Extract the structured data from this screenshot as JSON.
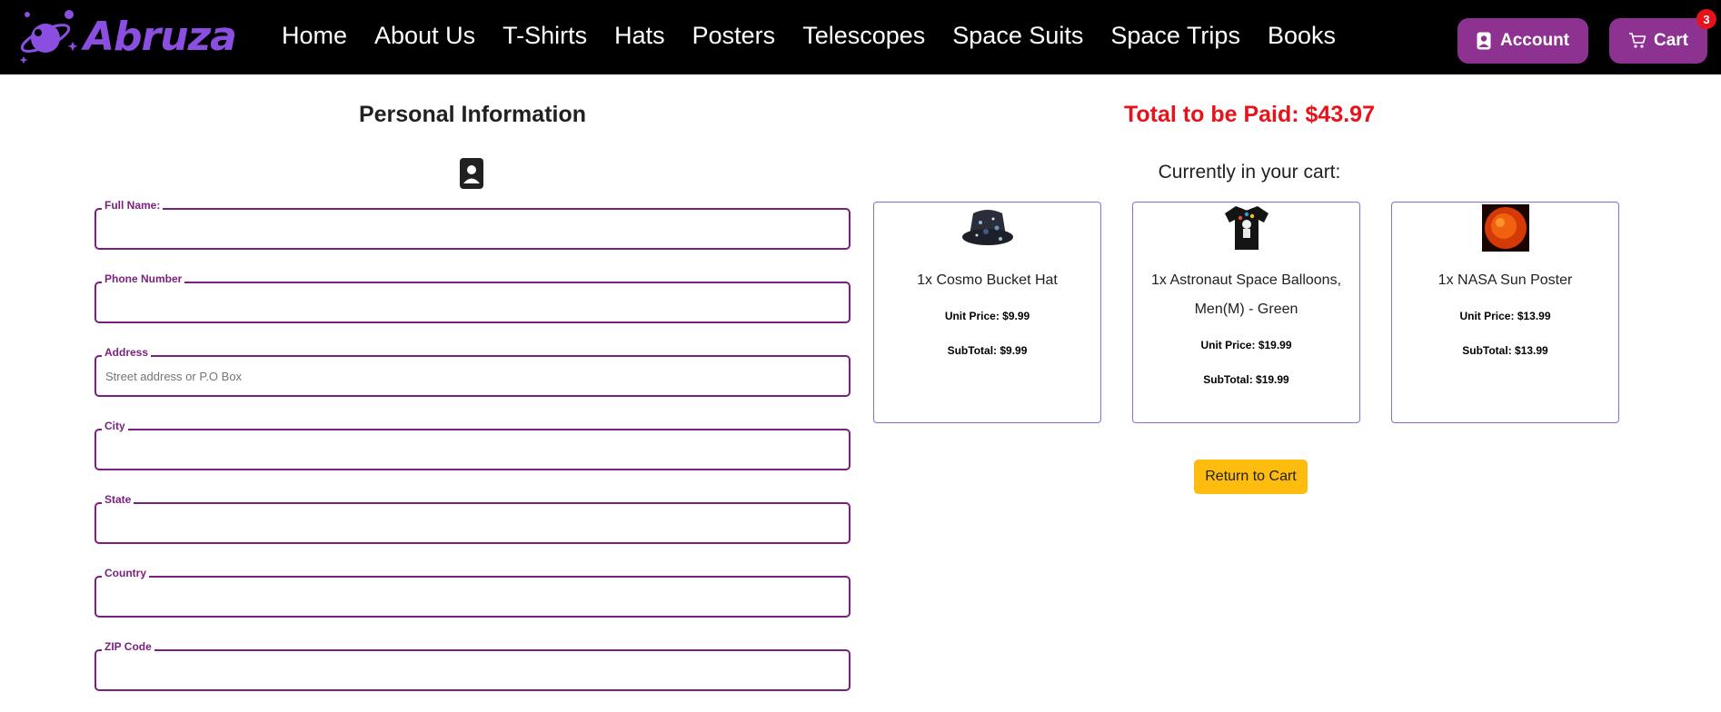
{
  "brand": {
    "name": "Abruza",
    "accent": "#8a4fe0"
  },
  "nav": {
    "links": [
      {
        "label": "Home"
      },
      {
        "label": "About Us"
      },
      {
        "label": "T-Shirts"
      },
      {
        "label": "Hats"
      },
      {
        "label": "Posters"
      },
      {
        "label": "Telescopes"
      },
      {
        "label": "Space Suits"
      },
      {
        "label": "Space Trips"
      },
      {
        "label": "Books"
      }
    ],
    "account_label": "Account",
    "cart_label": "Cart",
    "cart_count": "3"
  },
  "form": {
    "title": "Personal Information",
    "fields": [
      {
        "label": "Full Name:",
        "value": "",
        "placeholder": ""
      },
      {
        "label": "Phone Number",
        "value": "",
        "placeholder": ""
      },
      {
        "label": "Address",
        "value": "",
        "placeholder": "Street address or P.O Box"
      },
      {
        "label": "City",
        "value": "",
        "placeholder": ""
      },
      {
        "label": "State",
        "value": "",
        "placeholder": ""
      },
      {
        "label": "Country",
        "value": "",
        "placeholder": ""
      },
      {
        "label": "ZIP Code",
        "value": "",
        "placeholder": ""
      }
    ]
  },
  "summary": {
    "total_text": "Total to be Paid: $43.97",
    "cart_heading": "Currently in your cart:",
    "items": [
      {
        "name": "1x Cosmo Bucket Hat",
        "unit_price": "Unit Price: $9.99",
        "subtotal": "SubTotal: $9.99",
        "image": "bucket-hat"
      },
      {
        "name": "1x Astronaut Space Balloons, Men(M) - Green",
        "unit_price": "Unit Price: $19.99",
        "subtotal": "SubTotal: $19.99",
        "image": "astronaut-tshirt"
      },
      {
        "name": "1x NASA Sun Poster",
        "unit_price": "Unit Price: $13.99",
        "subtotal": "SubTotal: $13.99",
        "image": "sun-poster"
      }
    ],
    "return_label": "Return to Cart"
  },
  "colors": {
    "primary": "#8e3292",
    "total": "#e6131a",
    "return_button": "#fdbc0e"
  }
}
